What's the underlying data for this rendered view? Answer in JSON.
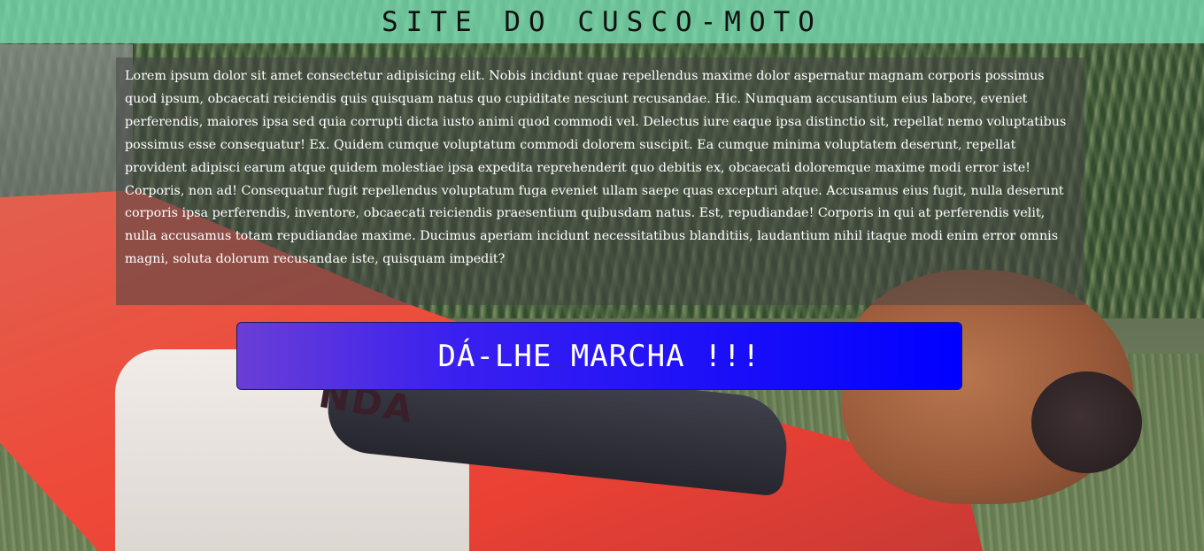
{
  "header": {
    "title": "SITE DO CUSCO-MOTO"
  },
  "content": {
    "paragraph": "Lorem ipsum dolor sit amet consectetur adipisicing elit. Nobis incidunt quae repellendus maxime dolor aspernatur magnam corporis possimus quod ipsum, obcaecati reiciendis quis quisquam natus quo cupiditate nesciunt recusandae. Hic. Numquam accusantium eius labore, eveniet perferendis, maiores ipsa sed quia corrupti dicta iusto animi quod commodi vel. Delectus iure eaque ipsa distinctio sit, repellat nemo voluptatibus possimus esse consequatur! Ex. Quidem cumque voluptatum commodi dolorem suscipit. Ea cumque minima voluptatem deserunt, repellat provident adipisci earum atque quidem molestiae ipsa expedita reprehenderit quo debitis ex, obcaecati doloremque maxime modi error iste! Corporis, non ad! Consequatur fugit repellendus voluptatum fuga eveniet ullam saepe quas excepturi atque. Accusamus eius fugit, nulla deserunt corporis ipsa perferendis, inventore, obcaecati reiciendis praesentium quibusdam natus. Est, repudiandae! Corporis in qui at perferendis velit, nulla accusamus totam repudiandae maxime. Ducimus aperiam incidunt necessitatibus blanditiis, laudantium nihil itaque modi enim error omnis magni, soluta dolorum recusandae iste, quisquam impedit?"
  },
  "action": {
    "button_label": "DÁ-LHE MARCHA !!!"
  },
  "background": {
    "brand_text": "NDA"
  },
  "colors": {
    "header_bg": "#78deb4",
    "button_bg": "#0000ff",
    "button_gradient_start": "#6a3ed6",
    "panel_text": "#ffffff"
  }
}
